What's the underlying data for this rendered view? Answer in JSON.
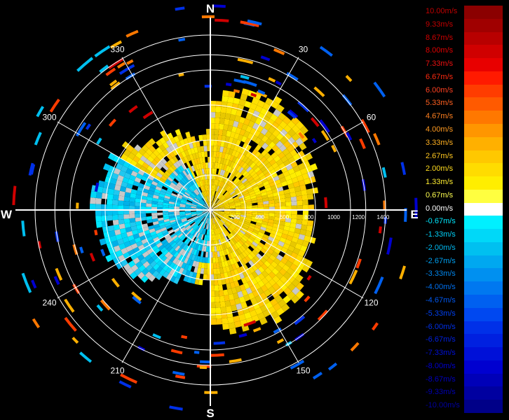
{
  "chart_data": {
    "type": "polar-heatmap",
    "compass": {
      "north": "N",
      "east": "E",
      "south": "S",
      "west": "W"
    },
    "angle_labels": [
      "30",
      "60",
      "120",
      "150",
      "210",
      "240",
      "300",
      "330"
    ],
    "angle_values": [
      30,
      60,
      120,
      150,
      210,
      240,
      300,
      330
    ],
    "range_labels": [
      "200",
      "400",
      "600",
      "800",
      "1000",
      "1200",
      "1400"
    ],
    "range_values": [
      200,
      400,
      600,
      800,
      1000,
      1200,
      1400
    ],
    "max_range": 1750,
    "unit": "m/s",
    "legend": [
      {
        "label": "10.00m/s",
        "color": "#8b0000",
        "text_color": "#c00000"
      },
      {
        "label": "9.33m/s",
        "color": "#a00000",
        "text_color": "#c00000"
      },
      {
        "label": "8.67m/s",
        "color": "#b80000",
        "text_color": "#d00000"
      },
      {
        "label": "8.00m/s",
        "color": "#d00000",
        "text_color": "#e00000"
      },
      {
        "label": "7.33m/s",
        "color": "#e80000",
        "text_color": "#ee1010"
      },
      {
        "label": "6.67m/s",
        "color": "#ff1a00",
        "text_color": "#ff2a10"
      },
      {
        "label": "6.00m/s",
        "color": "#ff3c00",
        "text_color": "#ff4020"
      },
      {
        "label": "5.33m/s",
        "color": "#ff5a00",
        "text_color": "#ff6020"
      },
      {
        "label": "4.67m/s",
        "color": "#ff7800",
        "text_color": "#ff8020"
      },
      {
        "label": "4.00m/s",
        "color": "#ff9600",
        "text_color": "#ff9a20"
      },
      {
        "label": "3.33m/s",
        "color": "#ffb000",
        "text_color": "#ffb020"
      },
      {
        "label": "2.67m/s",
        "color": "#ffc800",
        "text_color": "#ffc820"
      },
      {
        "label": "2.00m/s",
        "color": "#ffdc00",
        "text_color": "#ffdc20"
      },
      {
        "label": "1.33m/s",
        "color": "#ffee00",
        "text_color": "#ffee30"
      },
      {
        "label": "0.67m/s",
        "color": "#ffff40",
        "text_color": "#ffff50"
      },
      {
        "label": "0.00m/s",
        "color": "#ffffff",
        "text_color": "#ffffff"
      },
      {
        "label": "-0.67m/s",
        "color": "#00f0ff",
        "text_color": "#00e8ff"
      },
      {
        "label": "-1.33m/s",
        "color": "#00d8f8",
        "text_color": "#00d0f8"
      },
      {
        "label": "-2.00m/s",
        "color": "#00c0f0",
        "text_color": "#00b8f0"
      },
      {
        "label": "-2.67m/s",
        "color": "#00a8f0",
        "text_color": "#00a0f0"
      },
      {
        "label": "-3.33m/s",
        "color": "#0090f0",
        "text_color": "#0088f0"
      },
      {
        "label": "-4.00m/s",
        "color": "#0078f0",
        "text_color": "#0070f0"
      },
      {
        "label": "-4.67m/s",
        "color": "#0060f0",
        "text_color": "#0058f0"
      },
      {
        "label": "-5.33m/s",
        "color": "#0048f0",
        "text_color": "#0040f0"
      },
      {
        "label": "-6.00m/s",
        "color": "#0030e8",
        "text_color": "#0030e8"
      },
      {
        "label": "-6.67m/s",
        "color": "#0020e0",
        "text_color": "#0020e0"
      },
      {
        "label": "-7.33m/s",
        "color": "#0010d8",
        "text_color": "#0010d8"
      },
      {
        "label": "-8.00m/s",
        "color": "#0000d0",
        "text_color": "#0000d0"
      },
      {
        "label": "-8.67m/s",
        "color": "#0000b8",
        "text_color": "#0000c0"
      },
      {
        "label": "-9.33m/s",
        "color": "#0000a0",
        "text_color": "#0000b0"
      },
      {
        "label": "-10.00m/s",
        "color": "#000088",
        "text_color": "#0000a0"
      }
    ]
  }
}
